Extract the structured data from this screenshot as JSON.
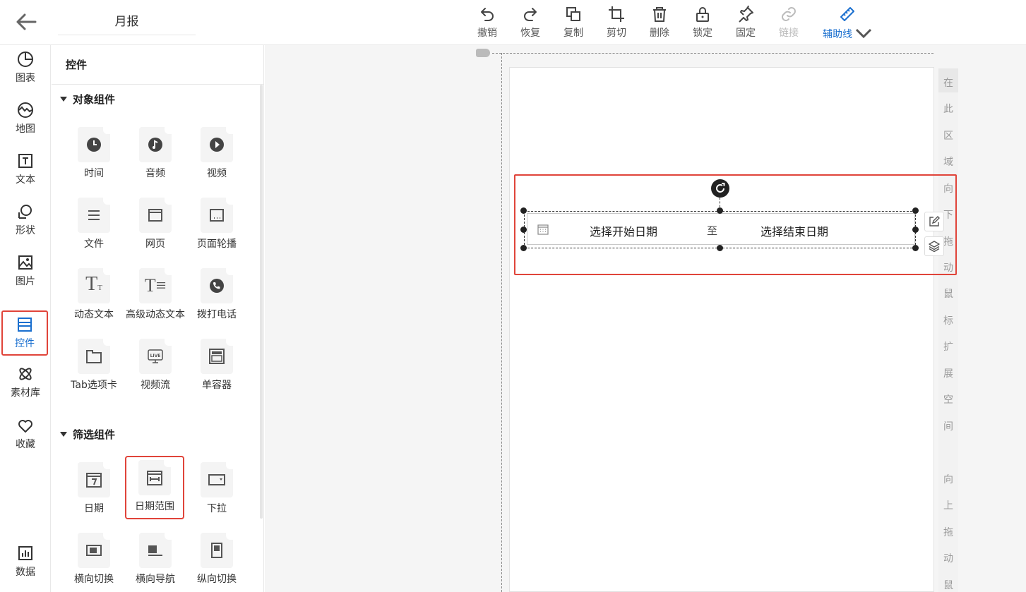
{
  "header": {
    "title": "月报",
    "toolbar": [
      {
        "label": "撤销",
        "icon": "undo-icon"
      },
      {
        "label": "恢复",
        "icon": "redo-icon"
      },
      {
        "label": "复制",
        "icon": "copy-icon"
      },
      {
        "label": "剪切",
        "icon": "crop-icon"
      },
      {
        "label": "删除",
        "icon": "trash-icon"
      },
      {
        "label": "锁定",
        "icon": "lock-icon"
      },
      {
        "label": "固定",
        "icon": "pin-icon"
      },
      {
        "label": "链接",
        "icon": "link-icon"
      },
      {
        "label": "辅助线",
        "icon": "ruler-icon"
      }
    ]
  },
  "leftnav": [
    {
      "label": "图表",
      "icon": "pie-chart-icon"
    },
    {
      "label": "地图",
      "icon": "map-icon"
    },
    {
      "label": "文本",
      "icon": "text-icon"
    },
    {
      "label": "形状",
      "icon": "shape-icon"
    },
    {
      "label": "图片",
      "icon": "image-icon"
    },
    {
      "label": "控件",
      "icon": "widget-icon"
    },
    {
      "label": "素材库",
      "icon": "atom-icon"
    },
    {
      "label": "收藏",
      "icon": "heart-icon"
    },
    {
      "label": "数据",
      "icon": "bar-chart-icon"
    }
  ],
  "panel": {
    "title": "控件",
    "sections": [
      {
        "title": "对象组件",
        "items": [
          "时间",
          "音频",
          "视频",
          "文件",
          "网页",
          "页面轮播",
          "动态文本",
          "高级动态文本",
          "拨打电话",
          "Tab选项卡",
          "视频流",
          "单容器"
        ]
      },
      {
        "title": "筛选组件",
        "items": [
          "日期",
          "日期范围",
          "下拉",
          "横向切换",
          "横向导航",
          "纵向切换"
        ]
      }
    ]
  },
  "canvas": {
    "date_range": {
      "start_placeholder": "选择开始日期",
      "separator": "至",
      "end_placeholder": "选择结束日期"
    },
    "hint_down": [
      "在",
      "此",
      "区",
      "域",
      "向",
      "下",
      "拖",
      "动",
      "鼠",
      "标",
      "扩",
      "展",
      "空",
      "间"
    ],
    "hint_up": [
      "向",
      "上",
      "拖",
      "动",
      "鼠"
    ]
  },
  "colors": {
    "accent": "#1a6fcf",
    "highlight": "#e0443a"
  }
}
